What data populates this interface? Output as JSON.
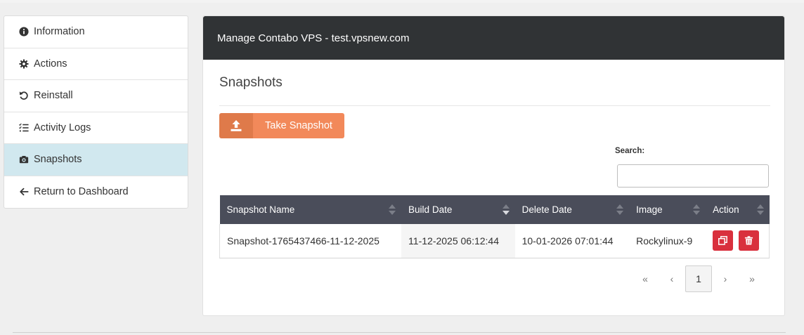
{
  "sidebar": {
    "items": [
      {
        "label": "Information",
        "icon": "info-circle-icon",
        "active": false
      },
      {
        "label": "Actions",
        "icon": "gear-icon",
        "active": false
      },
      {
        "label": "Reinstall",
        "icon": "undo-icon",
        "active": false
      },
      {
        "label": "Activity Logs",
        "icon": "list-check-icon",
        "active": false
      },
      {
        "label": "Snapshots",
        "icon": "camera-icon",
        "active": true
      },
      {
        "label": "Return to Dashboard",
        "icon": "arrow-left-icon",
        "active": false
      }
    ]
  },
  "panel": {
    "header": "Manage Contabo VPS - test.vpsnew.com",
    "section_title": "Snapshots",
    "take_snapshot_label": "Take Snapshot",
    "search_label": "Search:",
    "search_value": ""
  },
  "table": {
    "columns": [
      "Snapshot Name",
      "Build Date",
      "Delete Date",
      "Image",
      "Action"
    ],
    "sort_column": "Build Date",
    "sort_direction": "desc",
    "rows": [
      {
        "name": "Snapshot-1765437466-11-12-2025",
        "build_date": "11-12-2025 06:12:44",
        "delete_date": "10-01-2026 07:01:44",
        "image": "Rockylinux-9",
        "actions": [
          "restore-icon",
          "trash-icon"
        ]
      }
    ]
  },
  "pagination": {
    "first": "«",
    "prev": "‹",
    "current": "1",
    "next": "›",
    "last": "»"
  },
  "colors": {
    "header_bg": "#303335",
    "table_header_bg": "#4a4d5a",
    "active_sidebar_bg": "#d1e8ef",
    "snapshot_button": "#f2895a",
    "danger": "#d9303d"
  }
}
